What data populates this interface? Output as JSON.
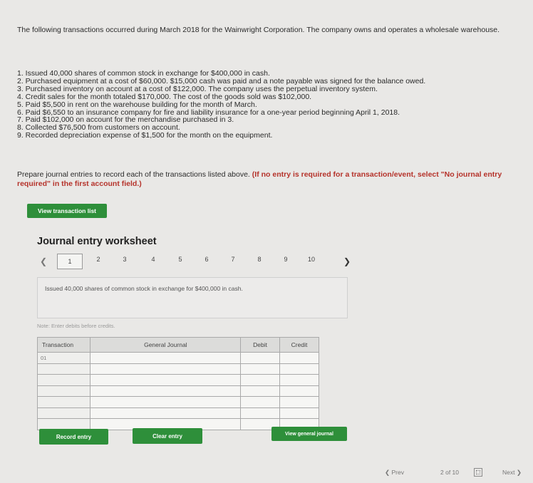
{
  "intro": "The following transactions occurred during March 2018 for the Wainwright Corporation. The company owns and operates a wholesale warehouse.",
  "transactions": [
    "1. Issued 40,000 shares of common stock in exchange for $400,000 in cash.",
    "2. Purchased equipment at a cost of $60,000. $15,000 cash was paid and a note payable was signed for the balance owed.",
    "3. Purchased inventory on account at a cost of $122,000. The company uses the perpetual inventory system.",
    "4. Credit sales for the month totaled $170,000. The cost of the goods sold was $102,000.",
    "5. Paid $5,500 in rent on the warehouse building for the month of March.",
    "6. Paid $6,550 to an insurance company for fire and liability insurance for a one-year period beginning April 1, 2018.",
    "7. Paid $102,000 on account for the merchandise purchased in 3.",
    "8. Collected $76,500 from customers on account.",
    "9. Recorded depreciation expense of $1,500 for the month on the equipment."
  ],
  "prompt": {
    "text": "Prepare journal entries to record each of the transactions listed above.",
    "instruction": "(If no entry is required for a transaction/event, select \"No journal entry required\" in the first account field.)"
  },
  "buttons": {
    "view_transaction_list": "View transaction list",
    "record_entry": "Record entry",
    "clear_entry": "Clear entry",
    "view_general_journal": "View general journal"
  },
  "worksheet": {
    "title": "Journal entry worksheet",
    "pages": [
      "1",
      "2",
      "3",
      "4",
      "5",
      "6",
      "7",
      "8",
      "9",
      "10"
    ],
    "active_page": "1",
    "description": "Issued 40,000 shares of common stock in exchange for $400,000 in cash.",
    "note": "Note: Enter debits before credits.",
    "columns": [
      "Transaction",
      "General Journal",
      "Debit",
      "Credit"
    ],
    "first_transaction": "01"
  },
  "footer": {
    "prev": "Prev",
    "page_indicator": "2 of 10",
    "next": "Next"
  },
  "colors": {
    "button_green": "#2e8f3a",
    "instruction_red": "#b5322a"
  }
}
